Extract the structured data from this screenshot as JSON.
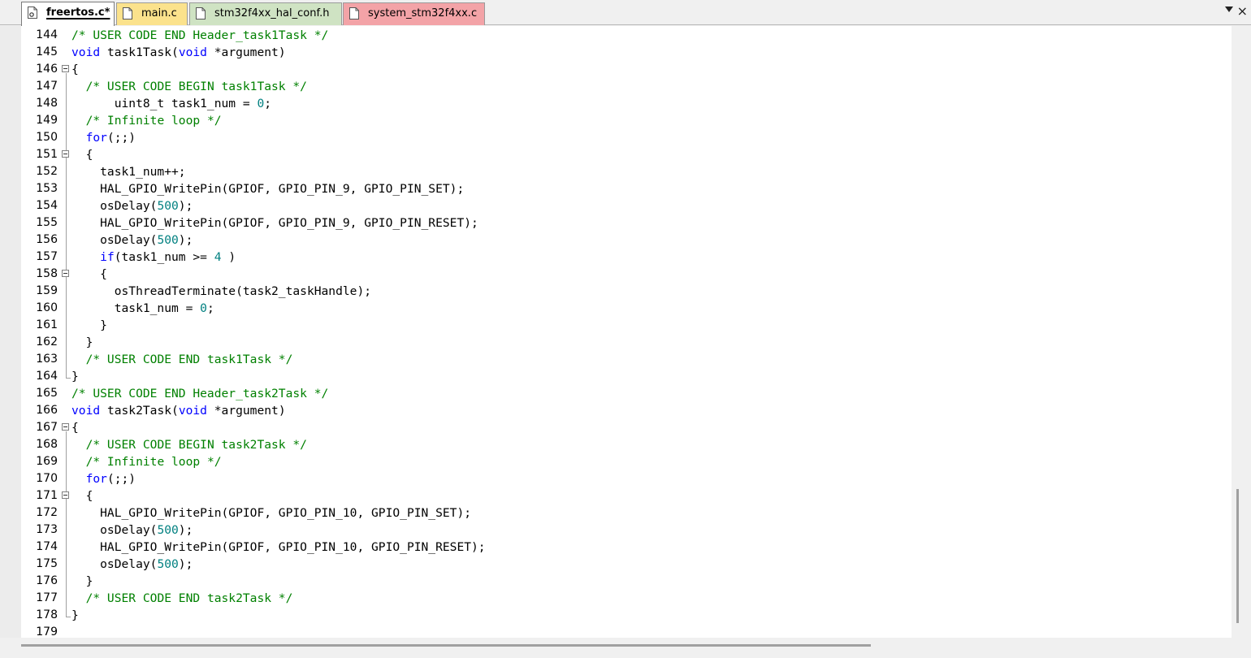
{
  "tabs": [
    {
      "name": "freertos.c*",
      "active": true,
      "color": "#ffffff",
      "icon": "gear-file-icon"
    },
    {
      "name": "main.c",
      "active": false,
      "color": "#fbe28c",
      "icon": "file-icon"
    },
    {
      "name": "stm32f4xx_hal_conf.h",
      "active": false,
      "color": "#cfe3c3",
      "icon": "file-icon"
    },
    {
      "name": "system_stm32f4xx.c",
      "active": false,
      "color": "#f3a3a7",
      "icon": "file-icon"
    }
  ],
  "colors": {
    "comment": "#008000",
    "keyword": "#0000ff",
    "number": "#008080"
  },
  "lines": [
    {
      "n": "144",
      "text": "/* USER CODE END Header_task1Task */"
    },
    {
      "n": "145",
      "text": "void task1Task(void *argument)"
    },
    {
      "n": "146",
      "text": "{"
    },
    {
      "n": "147",
      "text": "  /* USER CODE BEGIN task1Task */"
    },
    {
      "n": "148",
      "text": "      uint8_t task1_num = 0;"
    },
    {
      "n": "149",
      "text": "  /* Infinite loop */"
    },
    {
      "n": "150",
      "text": "  for(;;)"
    },
    {
      "n": "151",
      "text": "  {"
    },
    {
      "n": "152",
      "text": "    task1_num++;"
    },
    {
      "n": "153",
      "text": "    HAL_GPIO_WritePin(GPIOF, GPIO_PIN_9, GPIO_PIN_SET);"
    },
    {
      "n": "154",
      "text": "    osDelay(500);"
    },
    {
      "n": "155",
      "text": "    HAL_GPIO_WritePin(GPIOF, GPIO_PIN_9, GPIO_PIN_RESET);"
    },
    {
      "n": "156",
      "text": "    osDelay(500);"
    },
    {
      "n": "157",
      "text": "    if(task1_num >= 4 )"
    },
    {
      "n": "158",
      "text": "    {"
    },
    {
      "n": "159",
      "text": "      osThreadTerminate(task2_taskHandle);"
    },
    {
      "n": "160",
      "text": "      task1_num = 0;"
    },
    {
      "n": "161",
      "text": "    }"
    },
    {
      "n": "162",
      "text": "  }"
    },
    {
      "n": "163",
      "text": "  /* USER CODE END task1Task */"
    },
    {
      "n": "164",
      "text": "}"
    },
    {
      "n": "165",
      "text": "/* USER CODE END Header_task2Task */"
    },
    {
      "n": "166",
      "text": "void task2Task(void *argument)"
    },
    {
      "n": "167",
      "text": "{"
    },
    {
      "n": "168",
      "text": "  /* USER CODE BEGIN task2Task */"
    },
    {
      "n": "169",
      "text": "  /* Infinite loop */"
    },
    {
      "n": "170",
      "text": "  for(;;)"
    },
    {
      "n": "171",
      "text": "  {"
    },
    {
      "n": "172",
      "text": "    HAL_GPIO_WritePin(GPIOF, GPIO_PIN_10, GPIO_PIN_SET);"
    },
    {
      "n": "173",
      "text": "    osDelay(500);"
    },
    {
      "n": "174",
      "text": "    HAL_GPIO_WritePin(GPIOF, GPIO_PIN_10, GPIO_PIN_RESET);"
    },
    {
      "n": "175",
      "text": "    osDelay(500);"
    },
    {
      "n": "176",
      "text": "  }"
    },
    {
      "n": "177",
      "text": "  /* USER CODE END task2Task */"
    },
    {
      "n": "178",
      "text": "}"
    },
    {
      "n": "179",
      "text": ""
    }
  ],
  "fold": {
    "starts": [
      "146",
      "151",
      "158",
      "167",
      "171"
    ],
    "ends": [
      "164",
      "178"
    ]
  }
}
